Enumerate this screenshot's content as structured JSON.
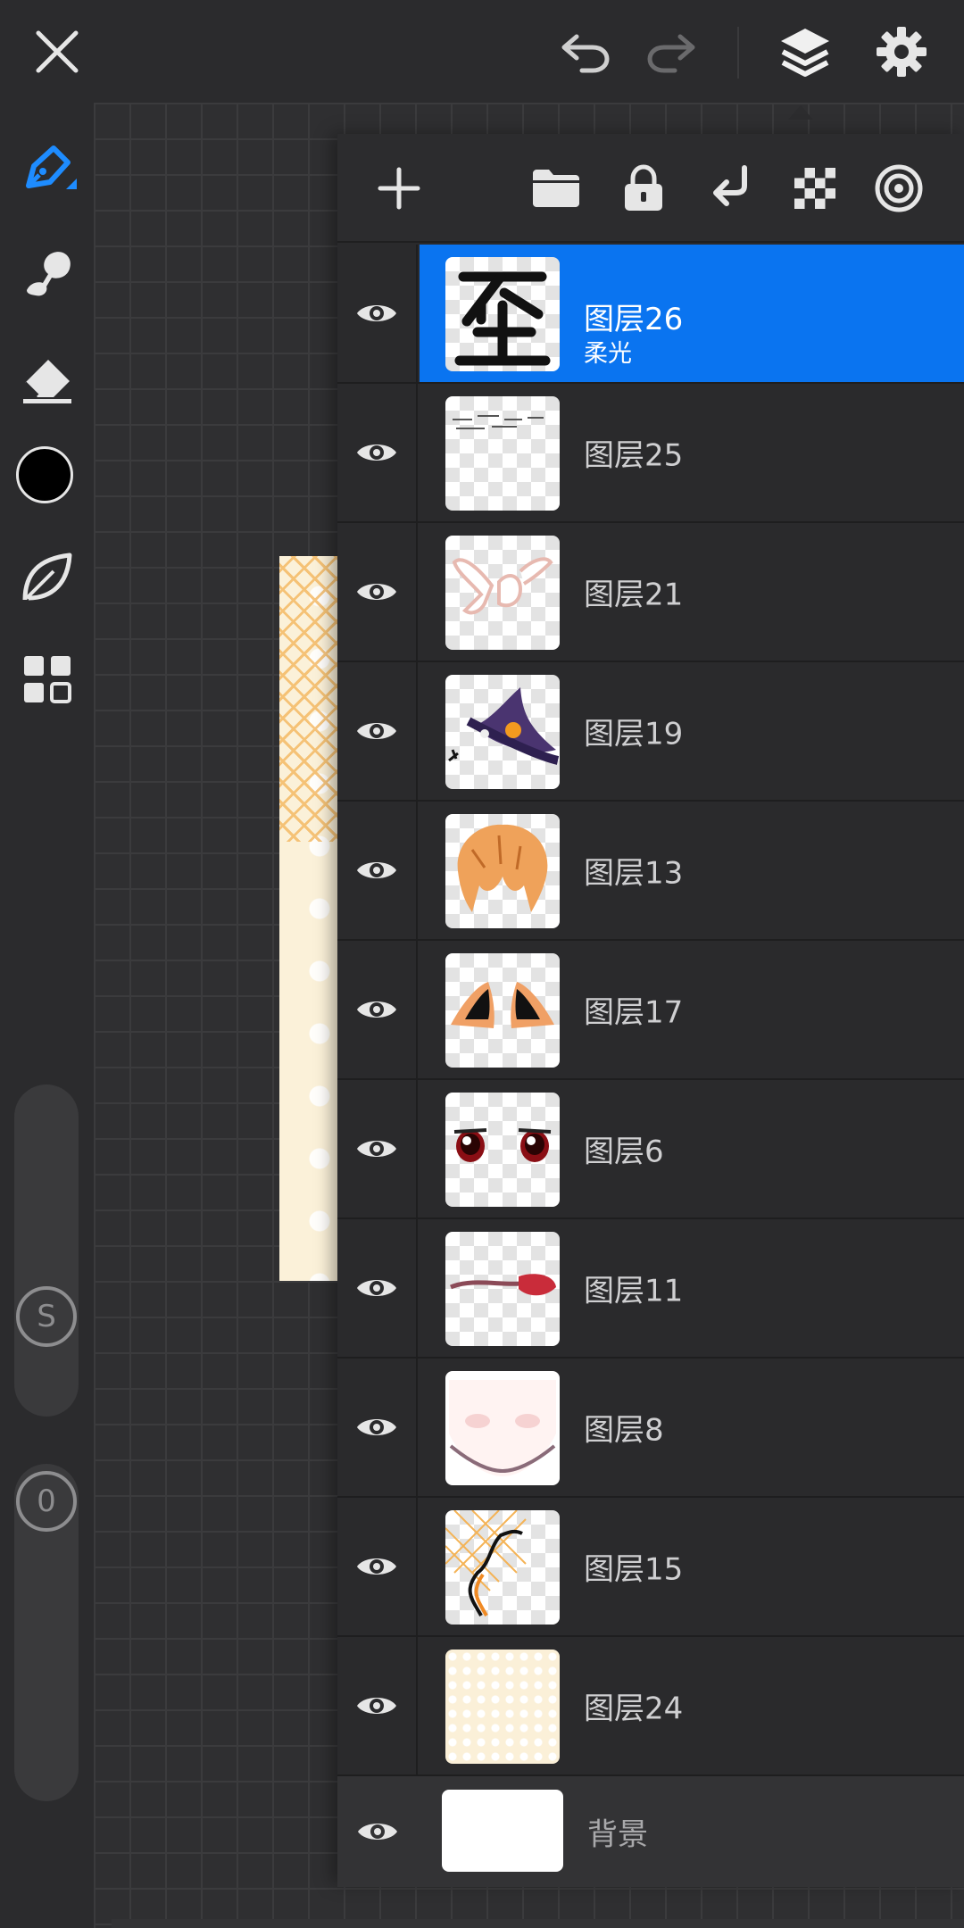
{
  "colors": {
    "accent": "#0a74f0",
    "panel": "#2a2a2c",
    "toolbar": "#2b2b2d",
    "current_color": "#000000"
  },
  "topbar": {
    "icons": [
      "close-icon",
      "undo-icon",
      "redo-icon",
      "layers-icon",
      "settings-icon"
    ]
  },
  "tools": {
    "icons": [
      "pen-tool-icon",
      "smudge-tool-icon",
      "eraser-tool-icon",
      "color-swatch",
      "leaf-tool-icon",
      "grid-tool-icon"
    ],
    "size_slider_label": "S",
    "opacity_slider_label": "0"
  },
  "layers_panel": {
    "header_icons": [
      "add-layer-icon",
      "folder-icon",
      "lock-icon",
      "merge-down-icon",
      "alpha-lock-icon",
      "target-icon"
    ],
    "layers": [
      {
        "name": "图层26",
        "blend": "柔光",
        "selected": true,
        "thumb": "char-wai"
      },
      {
        "name": "图层25",
        "thumb": "text-scribble"
      },
      {
        "name": "图层21",
        "thumb": "hand"
      },
      {
        "name": "图层19",
        "thumb": "witch-hat"
      },
      {
        "name": "图层13",
        "thumb": "hair"
      },
      {
        "name": "图层17",
        "thumb": "ears"
      },
      {
        "name": "图层6",
        "thumb": "eyes"
      },
      {
        "name": "图层11",
        "thumb": "mouth"
      },
      {
        "name": "图层8",
        "thumb": "face"
      },
      {
        "name": "图层15",
        "thumb": "frame"
      },
      {
        "name": "图层24",
        "thumb": "pattern"
      }
    ],
    "background_layer": {
      "name": "背景"
    }
  }
}
